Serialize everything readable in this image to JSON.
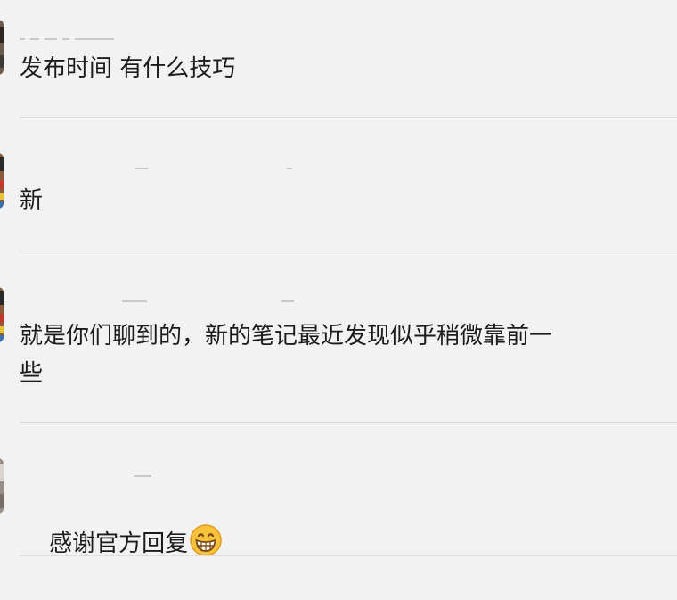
{
  "comments": [
    {
      "text": "发布时间 有什么技巧",
      "emoji": ""
    },
    {
      "text": "新",
      "emoji": ""
    },
    {
      "text": "就是你们聊到的，新的笔记最近发现似乎稍微靠前一些",
      "emoji": ""
    },
    {
      "text": "感谢官方回复",
      "emoji": "grinning-face-emoji"
    }
  ],
  "icons": {
    "avatar": "avatar-image",
    "emoji": "grinning-face-emoji"
  }
}
